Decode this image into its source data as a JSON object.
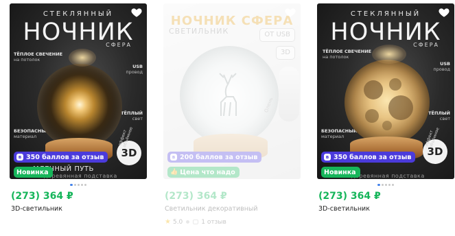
{
  "colors": {
    "price": "#16b55a",
    "points_badge": "#4b3bdb",
    "new_badge": "#16b55a",
    "dot_active": "#3d7eea"
  },
  "products": [
    {
      "image": {
        "kicker": "СТЕКЛЯННЫЙ",
        "headline": "НОЧНИК",
        "sub": "СФЕРА",
        "feature_glow_title": "ТЁПЛОЕ СВЕЧЕНИЕ",
        "feature_glow_sub": "на потолок",
        "feature_usb_title": "USB",
        "feature_usb_sub": "провод",
        "feature_warm_title": "ТЁПЛЫЙ",
        "feature_warm_sub": "свет",
        "feature_safe_title": "БЕЗОПАСНЫЙ",
        "feature_safe_sub": "материал",
        "badge_3d": "3D",
        "arc_text": "эффект объёмное",
        "caption": "МЛЕЧНЫЙ ПУТЬ",
        "caption2": "деревянная подставка"
      },
      "points_badge": "350 баллов за отзыв",
      "points_icon": "в",
      "status_badge": "Новинка",
      "price": "(273) 364 ₽",
      "title": "3D-светильник"
    },
    {
      "image": {
        "headline": "НОЧНИК СФЕРА",
        "sub": "СВЕТИЛЬНИК",
        "pill_usb": "ОТ USB",
        "pill_3d": "3D",
        "arc_text": "Олень"
      },
      "points_badge": "200 баллов за отзыв",
      "points_icon": "в",
      "status_badge": "Цена что надо",
      "price": "(273) 364 ₽",
      "title": "Светильник декоративный",
      "rating": "5.0",
      "reviews": "1 отзыв"
    },
    {
      "image": {
        "kicker": "СТЕКЛЯННЫЙ",
        "headline": "НОЧНИК",
        "sub": "СФЕРА",
        "feature_glow_title": "ТЁПЛОЕ СВЕЧЕНИЕ",
        "feature_glow_sub": "на потолок",
        "feature_usb_title": "USB",
        "feature_usb_sub": "провод",
        "feature_warm_title": "ТЁПЛЫЙ",
        "feature_warm_sub": "свет",
        "feature_safe_title": "БЕЗОПАСНЫЙ",
        "feature_safe_sub": "материал",
        "badge_3d": "3D",
        "arc_text": "эффект объёмное",
        "caption2": "деревянная подставка"
      },
      "points_badge": "350 баллов за отзыв",
      "points_icon": "в",
      "status_badge": "Новинка",
      "price": "(273) 364 ₽",
      "title": "3D-светильник"
    }
  ]
}
